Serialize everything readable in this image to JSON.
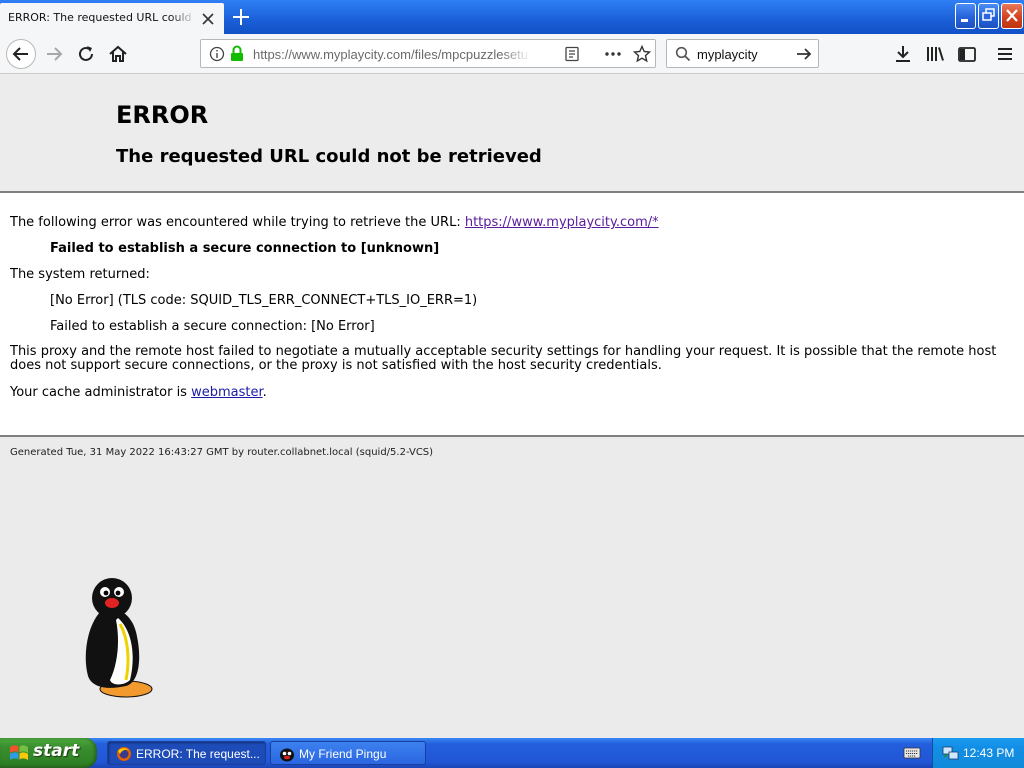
{
  "browser": {
    "tab_title": "ERROR: The requested URL could not be retrieved",
    "url": "https://www.myplaycity.com/files/mpcpuzzlesetup.exe",
    "search_value": "myplaycity"
  },
  "page": {
    "title": "ERROR",
    "subtitle": "The requested URL could not be retrieved",
    "intro_text": "The following error was encountered while trying to retrieve the URL: ",
    "intro_link": "https://www.myplaycity.com/*",
    "failure_text": "Failed to establish a secure connection to [unknown]",
    "system_returned": "The system returned:",
    "system_error": "[No Error] (TLS code: SQUID_TLS_ERR_CONNECT+TLS_IO_ERR=1)",
    "system_error_detail": "Failed to establish a secure connection: [No Error]",
    "explanation": "This proxy and the remote host failed to negotiate a mutually acceptable security settings for handling your request. It is possible that the remote host does not support secure connections, or the proxy is not satisfied with the host security credentials.",
    "admin_prefix": "Your cache administrator is ",
    "admin_link": "webmaster",
    "admin_suffix": ".",
    "generated": "Generated Tue, 31 May 2022 16:43:27 GMT by router.collabnet.local (squid/5.2-VCS)"
  },
  "taskbar": {
    "start_label": "start",
    "tasks": [
      {
        "label": "ERROR: The request...",
        "icon": "browser-icon",
        "active": true
      },
      {
        "label": "My Friend Pingu",
        "icon": "pingu-icon",
        "active": false
      }
    ],
    "clock": "12:43 PM"
  },
  "colors": {
    "titlebar_blue": "#1a5fd8",
    "link": "#1b1ba6",
    "visited_link": "#5a1b9b",
    "start_green": "#3a8e2f",
    "lock_green": "#12bc00"
  }
}
